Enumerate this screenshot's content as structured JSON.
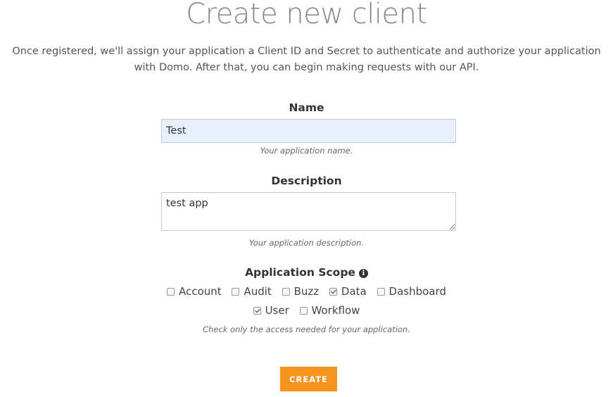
{
  "page": {
    "title": "Create new client",
    "intro": "Once registered, we'll assign your application a Client ID and Secret to authenticate and authorize your application with Domo. After that, you can begin making requests with our API."
  },
  "form": {
    "name": {
      "label": "Name",
      "value": "Test",
      "hint": "Your application name."
    },
    "description": {
      "label": "Description",
      "value": "test app",
      "hint": "Your application description."
    },
    "scope": {
      "label": "Application Scope",
      "info_icon": "info-circle-icon",
      "options": [
        {
          "label": "Account",
          "checked": false
        },
        {
          "label": "Audit",
          "checked": false
        },
        {
          "label": "Buzz",
          "checked": false
        },
        {
          "label": "Data",
          "checked": true
        },
        {
          "label": "Dashboard",
          "checked": false
        },
        {
          "label": "User",
          "checked": true
        },
        {
          "label": "Workflow",
          "checked": false
        }
      ],
      "hint": "Check only the access needed for your application."
    },
    "submit_label": "CREATE"
  },
  "colors": {
    "accent": "#f7941d",
    "input_autofill": "#e8f0fe"
  }
}
